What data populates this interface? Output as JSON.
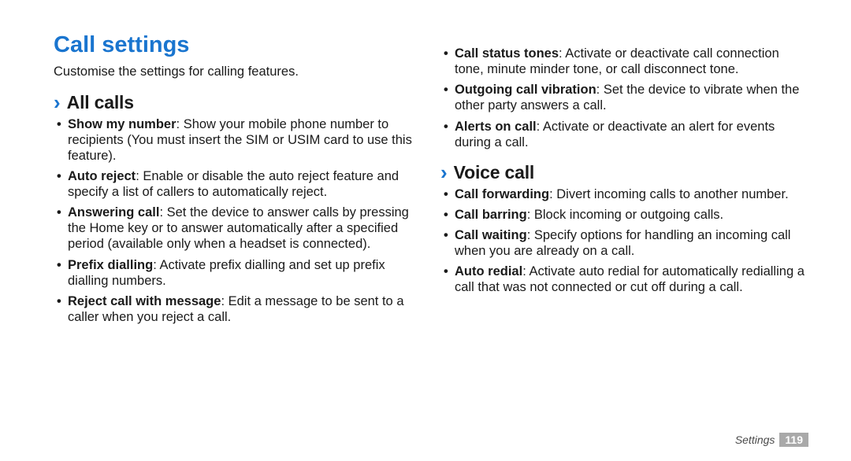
{
  "title": "Call settings",
  "intro": "Customise the settings for calling features.",
  "sections": {
    "all_calls": {
      "heading": "All calls",
      "items": [
        {
          "term": "Show my number",
          "desc": ": Show your mobile phone number to recipients (You must insert the SIM or USIM card to use this feature)."
        },
        {
          "term": "Auto reject",
          "desc": ": Enable or disable the auto reject feature and specify a list of callers to automatically reject."
        },
        {
          "term": "Answering call",
          "desc": ": Set the device to answer calls by pressing the Home key or to answer automatically after a specified period (available only when a headset is connected)."
        },
        {
          "term": "Prefix dialling",
          "desc": ": Activate prefix dialling and set up prefix dialling numbers."
        },
        {
          "term": "Reject call with message",
          "desc": ": Edit a message to be sent to a caller when you reject a call."
        },
        {
          "term": "Call status tones",
          "desc": ": Activate or deactivate call connection tone, minute minder tone, or call disconnect tone."
        },
        {
          "term": "Outgoing call vibration",
          "desc": ": Set the device to vibrate when the other party answers a call."
        },
        {
          "term": "Alerts on call",
          "desc": ": Activate or deactivate an alert for events during a call."
        }
      ]
    },
    "voice_call": {
      "heading": "Voice call",
      "items": [
        {
          "term": "Call forwarding",
          "desc": ": Divert incoming calls to another number."
        },
        {
          "term": "Call barring",
          "desc": ": Block incoming or outgoing calls."
        },
        {
          "term": "Call waiting",
          "desc": ": Specify options for handling an incoming call when you are already on a call."
        },
        {
          "term": "Auto redial",
          "desc": ": Activate auto redial for automatically redialling a call that was not connected or cut off during a call."
        }
      ]
    }
  },
  "footer": {
    "section": "Settings",
    "page": "119"
  }
}
